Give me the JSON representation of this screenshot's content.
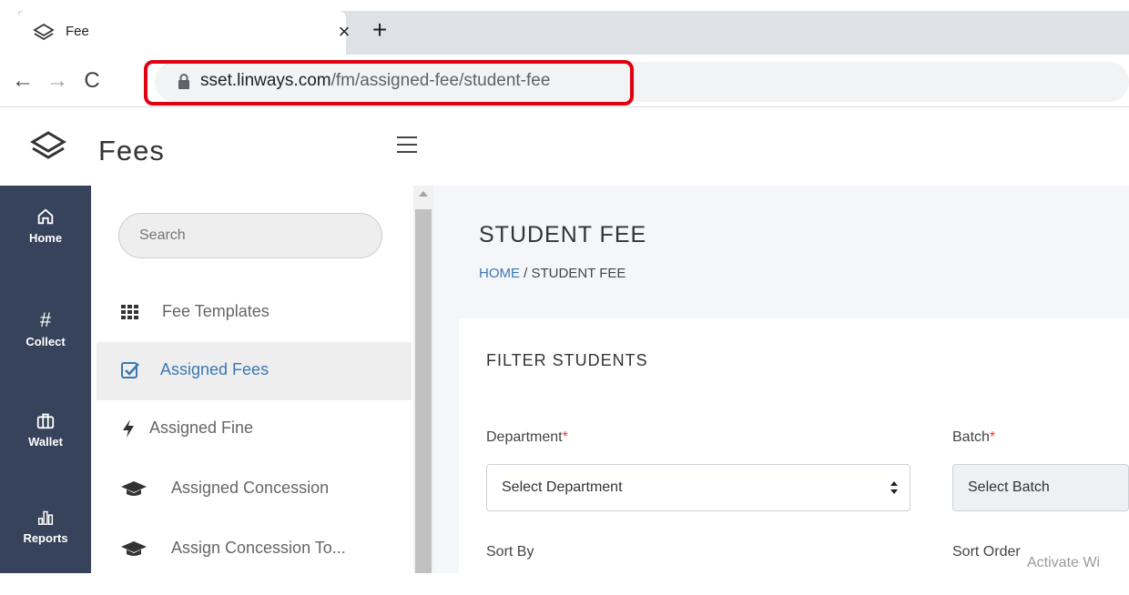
{
  "browser": {
    "tab_title": "Fee",
    "tab_close": "×",
    "new_tab": "+",
    "url_host": "sset.linways.com",
    "url_path": "/fm/assigned-fee/student-fee",
    "highlight_color": "#e0000f"
  },
  "app": {
    "title": "Fees"
  },
  "rail": {
    "items": [
      {
        "label": "Home",
        "icon": "home-icon"
      },
      {
        "label": "Collect",
        "icon": "hash-icon"
      },
      {
        "label": "Wallet",
        "icon": "wallet-icon"
      },
      {
        "label": "Reports",
        "icon": "bar-chart-icon"
      }
    ]
  },
  "subnav": {
    "search_placeholder": "Search",
    "items": [
      {
        "label": "Fee Templates",
        "icon": "grid-icon",
        "active": false
      },
      {
        "label": "Assigned Fees",
        "icon": "checkbox-icon",
        "active": true
      },
      {
        "label": "Assigned Fine",
        "icon": "bolt-icon",
        "active": false
      },
      {
        "label": "Assigned Concession",
        "icon": "graduation-cap-icon",
        "active": false
      },
      {
        "label": "Assign Concession To...",
        "icon": "graduation-cap-icon",
        "active": false
      }
    ]
  },
  "main": {
    "page_title": "STUDENT FEE",
    "breadcrumb_home": "HOME",
    "breadcrumb_sep": "/",
    "breadcrumb_current": "STUDENT FEE",
    "filter_title": "FILTER STUDENTS",
    "department_label": "Department",
    "department_value": "Select Department",
    "batch_label": "Batch",
    "batch_value": "Select Batch",
    "required_mark": "*",
    "sort_by_label": "Sort By",
    "sort_order_label": "Sort Order"
  },
  "watermark": "Activate Wi"
}
